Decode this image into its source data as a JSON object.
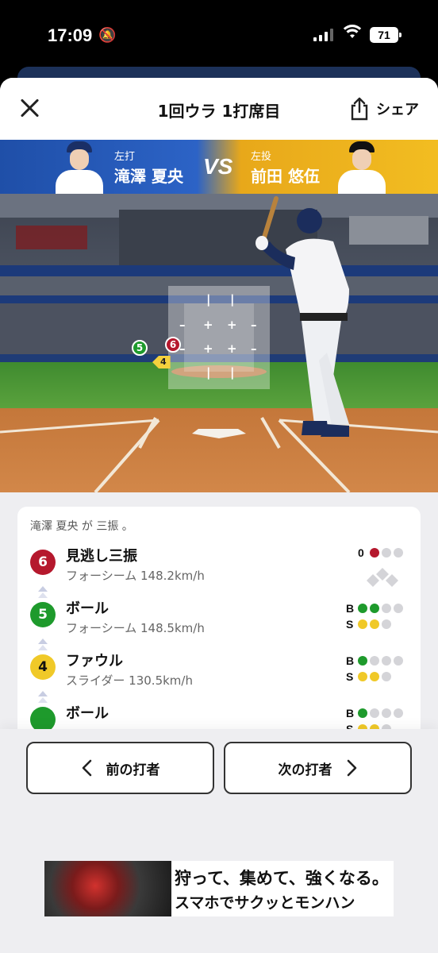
{
  "status": {
    "time": "17:09",
    "battery": "71"
  },
  "header": {
    "title": "1回ウラ 1打席目",
    "share_label": "シェア"
  },
  "matchup": {
    "batter": {
      "role": "左打",
      "name": "滝澤 夏央"
    },
    "vs": "VS",
    "pitcher": {
      "role": "左投",
      "name": "前田 悠伍"
    }
  },
  "field": {
    "markers": [
      {
        "num": "5",
        "color": "#1e9a2c"
      },
      {
        "num": "6",
        "color": "#b5182d"
      },
      {
        "num": "4",
        "color": "#f4d13d"
      }
    ]
  },
  "log": {
    "summary": "滝澤 夏央 が 三振 。",
    "pitches": [
      {
        "num": "6",
        "color": "#b5182d",
        "result": "見逃し三振",
        "detail": "フォーシーム 148.2km/h",
        "outs_label": "0",
        "outs": 1
      },
      {
        "num": "5",
        "color": "#1e9a2c",
        "result": "ボール",
        "detail": "フォーシーム 148.5km/h",
        "balls_label": "B",
        "strikes_label": "S",
        "balls": 2,
        "strikes": 2
      },
      {
        "num": "4",
        "color": "#f0c928",
        "result": "ファウル",
        "detail": "スライダー 130.5km/h",
        "balls_label": "B",
        "strikes_label": "S",
        "balls": 1,
        "strikes": 2
      },
      {
        "num": "",
        "color": "#1e9a2c",
        "result": "ボール",
        "detail": "",
        "balls_label": "B",
        "strikes_label": "S",
        "balls": 1,
        "strikes": 2
      }
    ]
  },
  "nav": {
    "prev_label": "前の打者",
    "next_label": "次の打者"
  },
  "ad": {
    "line1": "狩って、集めて、強くなる。",
    "line2": "スマホでサクッとモンハン"
  }
}
